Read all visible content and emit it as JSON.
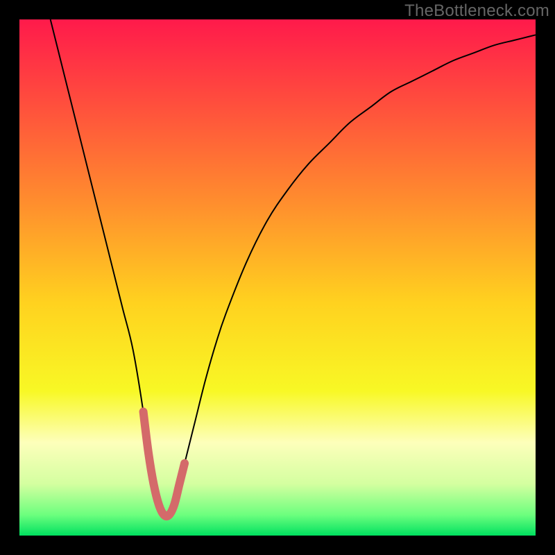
{
  "watermark": "TheBottleneck.com",
  "chart_data": {
    "type": "line",
    "title": "",
    "xlabel": "",
    "ylabel": "",
    "xlim": [
      0,
      100
    ],
    "ylim": [
      0,
      100
    ],
    "grid": false,
    "legend": false,
    "background_gradient_stops": [
      {
        "offset": 0.0,
        "color": "#ff1a4b"
      },
      {
        "offset": 0.15,
        "color": "#ff4a3e"
      },
      {
        "offset": 0.35,
        "color": "#ff8c2e"
      },
      {
        "offset": 0.55,
        "color": "#ffd21f"
      },
      {
        "offset": 0.72,
        "color": "#f8f825"
      },
      {
        "offset": 0.82,
        "color": "#fdffbb"
      },
      {
        "offset": 0.9,
        "color": "#d4ffa0"
      },
      {
        "offset": 0.96,
        "color": "#6cff7e"
      },
      {
        "offset": 1.0,
        "color": "#00e060"
      }
    ],
    "series": [
      {
        "name": "bottleneck-curve",
        "stroke": "#000000",
        "stroke_width": 2,
        "x": [
          6,
          8,
          10,
          12,
          14,
          16,
          18,
          20,
          22,
          24,
          25,
          26,
          27,
          28,
          29,
          30,
          31,
          32,
          34,
          36,
          38,
          40,
          44,
          48,
          52,
          56,
          60,
          64,
          68,
          72,
          76,
          80,
          84,
          88,
          92,
          96,
          100
        ],
        "y": [
          100,
          92,
          84,
          76,
          68,
          60,
          52,
          44,
          36,
          24,
          16,
          10,
          6,
          4,
          4,
          6,
          10,
          14,
          22,
          30,
          37,
          43,
          53,
          61,
          67,
          72,
          76,
          80,
          83,
          86,
          88,
          90,
          92,
          93.5,
          95,
          96,
          97
        ]
      },
      {
        "name": "optimal-zone-highlight",
        "stroke": "#d46a6a",
        "stroke_width": 12,
        "linecap": "round",
        "x": [
          24,
          25,
          26,
          27,
          28,
          29,
          30,
          31,
          32
        ],
        "y": [
          24,
          16,
          10,
          6,
          4,
          4,
          6,
          10,
          14
        ]
      }
    ]
  }
}
